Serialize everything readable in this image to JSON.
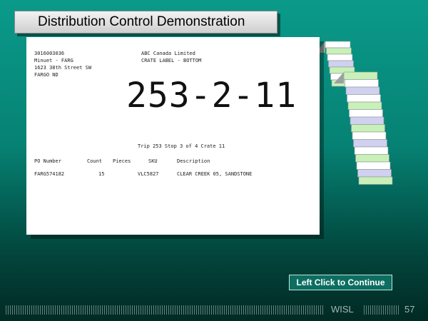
{
  "slide": {
    "title": "Distribution Control Demonstration",
    "continue_button": "Left Click to Continue",
    "footer_brand": "WISL",
    "page_number": "57"
  },
  "label": {
    "header_left": [
      "3016003036",
      "Minuet - FARG",
      "1623 38th Street SW",
      "FARGO ND"
    ],
    "header_right": [
      "ABC Canada Limited",
      "CRATE LABEL - BOTTOM"
    ],
    "big_number": "253-2-11",
    "trip_line": "Trip 253 Stop 3 of 4 Crate 11",
    "columns": [
      "PO Number",
      "Count",
      "Pieces",
      "SKU",
      "Description"
    ],
    "row": [
      "FARG574182",
      "15",
      "",
      "VLC5827",
      "CLEAR CREEK 05, SANDSTONE"
    ]
  },
  "colors": {
    "strip_green": "#c8f0b8",
    "strip_blue": "#d0d0f0",
    "strip_white": "#ffffff"
  }
}
